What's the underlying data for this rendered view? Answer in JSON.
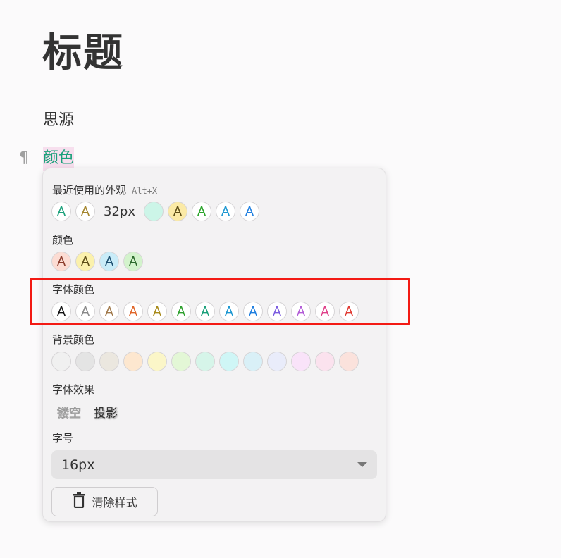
{
  "document": {
    "title": "标题",
    "paragraphs": [
      "思源",
      "颜色"
    ],
    "pilcrow": "¶"
  },
  "popup": {
    "recent": {
      "title": "最近使用的外观",
      "shortcut": "Alt+X",
      "items": [
        {
          "kind": "chip",
          "text": "A",
          "color": "#1aa07a",
          "bg": "#ffffff"
        },
        {
          "kind": "chip",
          "text": "A",
          "color": "#a3842b",
          "bg": "#ffffff"
        },
        {
          "kind": "text",
          "text": "32px"
        },
        {
          "kind": "chip",
          "text": "",
          "color": "#1aa07a",
          "bg": "#ccf5e8"
        },
        {
          "kind": "chip",
          "text": "A",
          "color": "#5c4d16",
          "bg": "#fbeaa6"
        },
        {
          "kind": "chip",
          "text": "A",
          "color": "#29a329",
          "bg": "#ffffff"
        },
        {
          "kind": "chip",
          "text": "A",
          "color": "#1c97d1",
          "bg": "#ffffff"
        },
        {
          "kind": "chip",
          "text": "A",
          "color": "#1f7fe0",
          "bg": "#ffffff"
        }
      ]
    },
    "colors": {
      "title": "颜色",
      "items": [
        {
          "text": "A",
          "color": "#8a3a2a",
          "bg": "#fcdcd3"
        },
        {
          "text": "A",
          "color": "#5c4d16",
          "bg": "#fbf1ac"
        },
        {
          "text": "A",
          "color": "#1c4f70",
          "bg": "#c9ecf8"
        },
        {
          "text": "A",
          "color": "#2c6a2c",
          "bg": "#d3f3cc"
        }
      ]
    },
    "font_colors": {
      "title": "字体颜色",
      "items": [
        {
          "text": "A",
          "color": "#111111"
        },
        {
          "text": "A",
          "color": "#888888"
        },
        {
          "text": "A",
          "color": "#a0784a"
        },
        {
          "text": "A",
          "color": "#e0662a"
        },
        {
          "text": "A",
          "color": "#a88a1a"
        },
        {
          "text": "A",
          "color": "#2ea02e"
        },
        {
          "text": "A",
          "color": "#1aa07a"
        },
        {
          "text": "A",
          "color": "#1c97d1"
        },
        {
          "text": "A",
          "color": "#1f7fe0"
        },
        {
          "text": "A",
          "color": "#7b5ce0"
        },
        {
          "text": "A",
          "color": "#b25cd6"
        },
        {
          "text": "A",
          "color": "#e0408a"
        },
        {
          "text": "A",
          "color": "#e03a32"
        }
      ]
    },
    "bg_colors": {
      "title": "背景颜色",
      "items": [
        "#f0f0f0",
        "#e4e4e4",
        "#ebe7df",
        "#fde7cf",
        "#fbf6c8",
        "#e3f7d6",
        "#d6f5e9",
        "#cff6f6",
        "#d9f0f7",
        "#e9ecfa",
        "#f9e3f9",
        "#fbe2ee",
        "#fbe2dc"
      ]
    },
    "effects": {
      "title": "字体效果",
      "hollow": "镂空",
      "shadow": "投影"
    },
    "font_size": {
      "title": "字号",
      "value": "16px"
    },
    "clear_label": "清除样式"
  },
  "annotation": {
    "highlight_color": "#f31a14"
  }
}
